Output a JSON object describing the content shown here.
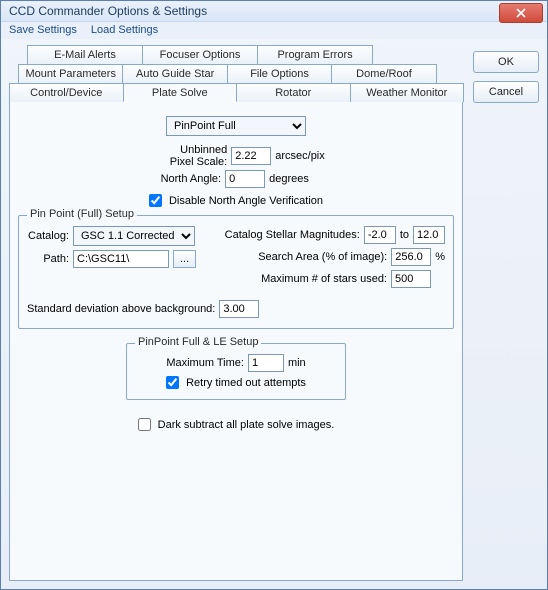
{
  "window": {
    "title": "CCD Commander Options & Settings"
  },
  "menubar": {
    "save": "Save Settings",
    "load": "Load Settings"
  },
  "buttons": {
    "ok": "OK",
    "cancel": "Cancel"
  },
  "tabs": {
    "row1": [
      "E-Mail Alerts",
      "Focuser Options",
      "Program Errors"
    ],
    "row2": [
      "Mount Parameters",
      "Auto Guide Star",
      "File Options",
      "Dome/Roof"
    ],
    "row3": [
      "Control/Device",
      "Plate Solve",
      "Rotator",
      "Weather Monitor"
    ]
  },
  "engine_select": "PinPoint Full",
  "pixel_scale": {
    "label1": "Unbinned",
    "label2": "Pixel Scale:",
    "value": "2.22",
    "unit": "arcsec/pix"
  },
  "north_angle": {
    "label": "North Angle:",
    "value": "0",
    "unit": "degrees"
  },
  "disable_north": "Disable North Angle Verification",
  "pinpoint_full": {
    "legend": "Pin Point (Full) Setup",
    "catalog_label": "Catalog:",
    "catalog_value": "GSC 1.1 Corrected",
    "path_label": "Path:",
    "path_value": "C:\\GSC11\\",
    "browse": "...",
    "mag_label": "Catalog Stellar Magnitudes:",
    "mag_lo": "-2.0",
    "mag_to": "to",
    "mag_hi": "12.0",
    "search_label": "Search Area (% of image):",
    "search_value": "256.0",
    "search_unit": "%",
    "maxstars_label": "Maximum # of stars used:",
    "maxstars_value": "500",
    "stddev_label": "Standard deviation above background:",
    "stddev_value": "3.00"
  },
  "pinpoint_le": {
    "legend": "PinPoint Full & LE Setup",
    "maxtime_label": "Maximum Time:",
    "maxtime_value": "1",
    "maxtime_unit": "min",
    "retry": "Retry timed out attempts"
  },
  "dark_subtract": "Dark subtract all plate solve images."
}
